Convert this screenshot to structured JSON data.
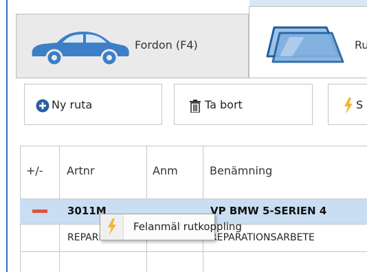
{
  "tabs": [
    {
      "label": "Fordon (F4)",
      "icon": "car-icon"
    },
    {
      "label": "Ru",
      "icon": "windshield-icon"
    }
  ],
  "toolbar": {
    "new_label": "Ny ruta",
    "new_icon": "plus-circle-icon",
    "delete_label": "Ta bort",
    "delete_icon": "trash-icon",
    "third_label": "S",
    "third_icon": "lightning-icon"
  },
  "table": {
    "columns": [
      "+/-",
      "Artnr",
      "Anm",
      "Benämning"
    ],
    "rows": [
      {
        "toggle": "minus",
        "artnr": "3011M",
        "anm": "",
        "benamning": "VP BMW 5-SERIEN 4",
        "selected": true
      },
      {
        "toggle": "",
        "artnr": "REPARB",
        "anm": "",
        "benamning": "REPARATIONSARBETE",
        "selected": false
      }
    ]
  },
  "context_menu": {
    "item_label": "Felanmäl rutkoppling",
    "item_icon": "lightning-icon"
  },
  "colors": {
    "accent_blue": "#2f6fb4",
    "selection": "#c9def2",
    "minus_red": "#e2523e",
    "lightning_yellow": "#f2b632"
  }
}
